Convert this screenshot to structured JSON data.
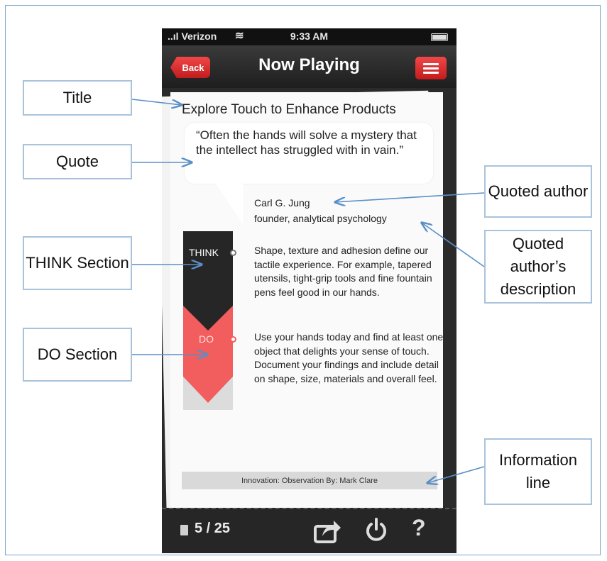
{
  "status_bar": {
    "carrier": "Verizon",
    "time": "9:33 AM"
  },
  "nav": {
    "back_label": "Back",
    "title": "Now Playing"
  },
  "card": {
    "title": "Explore Touch to Enhance Products",
    "quote": "“Often the hands will solve a mystery that the intellect has struggled with in vain.”",
    "author_name": "Carl G. Jung",
    "author_description": "founder, analytical psychology",
    "think_label": "THINK",
    "think_text": "Shape, texture and adhesion define our tactile experience. For example, tapered utensils, tight-grip tools and fine fountain pens feel good in our hands.",
    "do_label": "DO",
    "do_text": "Use your hands today and find at least one object that delights your sense of touch.  Document your findings and include detail on shape, size, materials and overall feel.",
    "info_line": "Innovation: Observation By: Mark Clare"
  },
  "bottom_bar": {
    "page_counter": "5 / 25",
    "help_glyph": "?"
  },
  "callouts": {
    "title": "Title",
    "quote": "Quote",
    "think_section": "THINK Section",
    "do_section": "DO Section",
    "quoted_author": "Quoted author",
    "author_description": "Quoted author’s description",
    "information_line": "Information line"
  },
  "colors": {
    "accent_red": "#e33232",
    "do_coral": "#f25d5d",
    "callout_border": "#a9c3dc",
    "arrow": "#5b8fc7"
  }
}
